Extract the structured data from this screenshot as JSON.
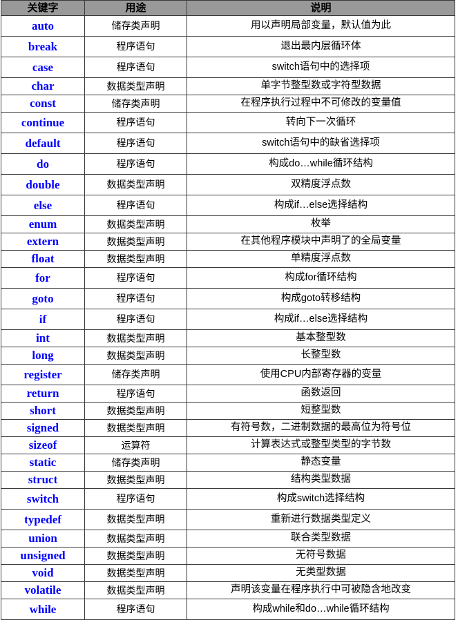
{
  "table": {
    "columns": [
      {
        "label": "关键字",
        "key": "keyword"
      },
      {
        "label": "用途",
        "key": "usage"
      },
      {
        "label": "说明",
        "key": "description"
      }
    ],
    "header_bg": "#999999",
    "keyword_color": "#0000ff",
    "border_color": "#3a3a3a",
    "rows": [
      {
        "keyword": "auto",
        "usage": "储存类声明",
        "description": "用以声明局部变量，默认值为此",
        "tall": true
      },
      {
        "keyword": "break",
        "usage": "程序语句",
        "description": "退出最内层循环体",
        "tall": true
      },
      {
        "keyword": "case",
        "usage": "程序语句",
        "description": "switch语句中的选择项",
        "tall": true
      },
      {
        "keyword": "char",
        "usage": "数据类型声明",
        "description": "单字节整型数或字符型数据",
        "tall": false
      },
      {
        "keyword": "const",
        "usage": "储存类声明",
        "description": "在程序执行过程中不可修改的变量值",
        "tall": false
      },
      {
        "keyword": "continue",
        "usage": "程序语句",
        "description": "转向下一次循环",
        "tall": true
      },
      {
        "keyword": "default",
        "usage": "程序语句",
        "description": "switch语句中的缺省选择项",
        "tall": true
      },
      {
        "keyword": "do",
        "usage": "程序语句",
        "description": "构成do…while循环结构",
        "tall": true
      },
      {
        "keyword": "double",
        "usage": "数据类型声明",
        "description": "双精度浮点数",
        "tall": true
      },
      {
        "keyword": "else",
        "usage": "程序语句",
        "description": "构成if…else选择结构",
        "tall": true
      },
      {
        "keyword": "enum",
        "usage": "数据类型声明",
        "description": "枚举",
        "tall": false
      },
      {
        "keyword": "extern",
        "usage": "数据类型声明",
        "description": "在其他程序模块中声明了的全局变量",
        "tall": false
      },
      {
        "keyword": "float",
        "usage": "数据类型声明",
        "description": "单精度浮点数",
        "tall": false
      },
      {
        "keyword": "for",
        "usage": "程序语句",
        "description": "构成for循环结构",
        "tall": true
      },
      {
        "keyword": "goto",
        "usage": "程序语句",
        "description": "构成goto转移结构",
        "tall": true
      },
      {
        "keyword": "if",
        "usage": "程序语句",
        "description": "构成if…else选择结构",
        "tall": true
      },
      {
        "keyword": "int",
        "usage": "数据类型声明",
        "description": "基本整型数",
        "tall": false
      },
      {
        "keyword": "long",
        "usage": "数据类型声明",
        "description": "长整型数",
        "tall": false
      },
      {
        "keyword": "register",
        "usage": "储存类声明",
        "description": "使用CPU内部寄存器的变量",
        "tall": true
      },
      {
        "keyword": "return",
        "usage": "程序语句",
        "description": "函数返回",
        "tall": false
      },
      {
        "keyword": "short",
        "usage": "数据类型声明",
        "description": "短整型数",
        "tall": false
      },
      {
        "keyword": "signed",
        "usage": "数据类型声明",
        "description": "有符号数，二进制数据的最高位为符号位",
        "tall": false
      },
      {
        "keyword": "sizeof",
        "usage": "运算符",
        "description": "计算表达式或整型类型的字节数",
        "tall": false
      },
      {
        "keyword": "static",
        "usage": "储存类声明",
        "description": "静态变量",
        "tall": false
      },
      {
        "keyword": "struct",
        "usage": "数据类型声明",
        "description": "结构类型数据",
        "tall": false
      },
      {
        "keyword": "switch",
        "usage": "程序语句",
        "description": "构成switch选择结构",
        "tall": true
      },
      {
        "keyword": "typedef",
        "usage": "数据类型声明",
        "description": "重新进行数据类型定义",
        "tall": true
      },
      {
        "keyword": "union",
        "usage": "数据类型声明",
        "description": "联合类型数据",
        "tall": false
      },
      {
        "keyword": "unsigned",
        "usage": "数据类型声明",
        "description": "无符号数据",
        "tall": false
      },
      {
        "keyword": "void",
        "usage": "数据类型声明",
        "description": "无类型数据",
        "tall": false
      },
      {
        "keyword": "volatile",
        "usage": "数据类型声明",
        "description": "声明该变量在程序执行中可被隐含地改变",
        "tall": false
      },
      {
        "keyword": "while",
        "usage": "程序语句",
        "description": "构成while和do…while循环结构",
        "tall": true
      }
    ]
  }
}
